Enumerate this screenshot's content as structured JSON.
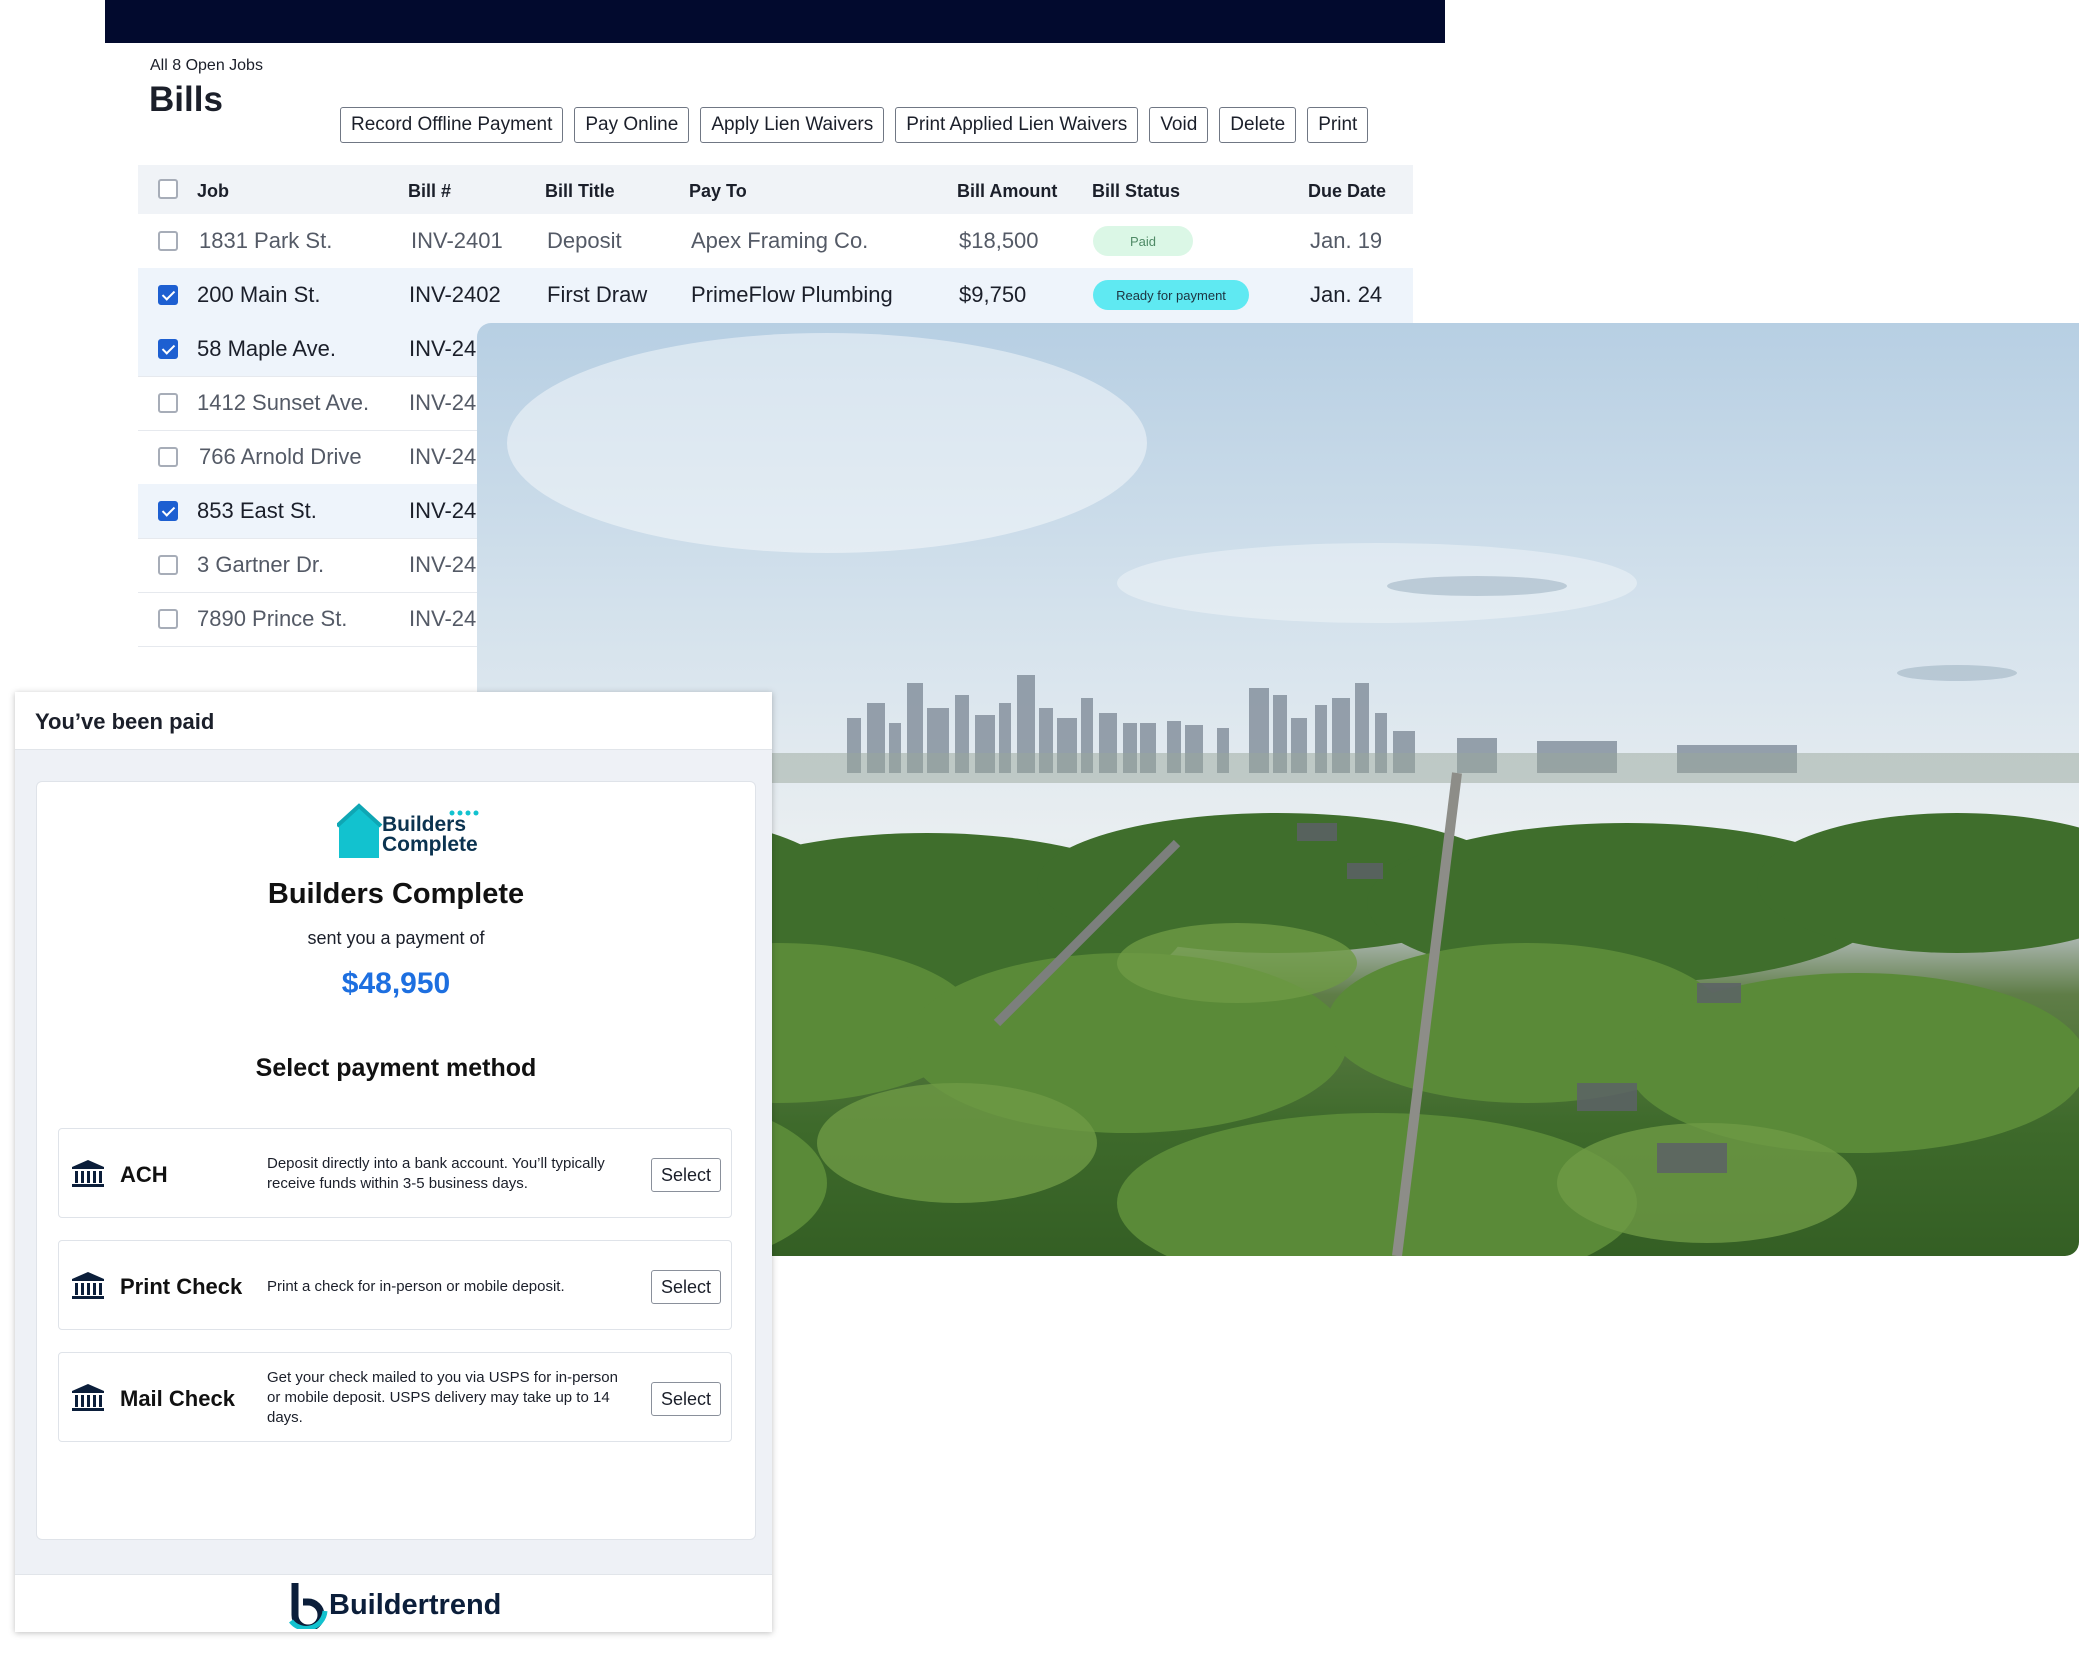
{
  "bills": {
    "breadcrumb": "All 8 Open Jobs",
    "title": "Bills",
    "toolbar": [
      "Record Offline Payment",
      "Pay Online",
      "Apply Lien Waivers",
      "Print Applied Lien Waivers",
      "Void",
      "Delete",
      "Print"
    ],
    "columns": {
      "job": "Job",
      "bill_no": "Bill #",
      "bill_title": "Bill Title",
      "pay_to": "Pay To",
      "bill_amount": "Bill Amount",
      "bill_status": "Bill Status",
      "due_date": "Due Date"
    },
    "rows": [
      {
        "job": "1831 Park St.",
        "bill_no": "INV-2401",
        "bill_title": "Deposit",
        "pay_to": "Apex Framing Co.",
        "amount": "$18,500",
        "status": "Paid",
        "due": "Jan. 19",
        "checked": false
      },
      {
        "job": "200 Main St.",
        "bill_no": "INV-2402",
        "bill_title": "First Draw",
        "pay_to": "PrimeFlow Plumbing",
        "amount": "$9,750",
        "status": "Ready for payment",
        "due": "Jan. 24",
        "checked": true
      },
      {
        "job": "58 Maple Ave.",
        "bill_no": "INV-24",
        "checked": true
      },
      {
        "job": "1412 Sunset Ave.",
        "bill_no": "INV-24",
        "checked": false
      },
      {
        "job": "766 Arnold Drive",
        "bill_no": "INV-24",
        "checked": false
      },
      {
        "job": "853 East St.",
        "bill_no": "INV-24",
        "checked": true
      },
      {
        "job": "3 Gartner Dr.",
        "bill_no": "INV-24",
        "checked": false
      },
      {
        "job": "7890 Prince St.",
        "bill_no": "INV-24",
        "checked": false
      }
    ]
  },
  "payment": {
    "header": "You’ve been paid",
    "logo_line1": "Builders",
    "logo_line2": "Complete",
    "company": "Builders Complete",
    "sent_text": "sent you a payment of",
    "amount": "$48,950",
    "select_heading": "Select payment method",
    "methods": [
      {
        "name": "ACH",
        "desc": "Deposit directly into a bank account. You’ll typically receive funds within 3-5 business days.",
        "button": "Select",
        "icon": "bank-icon"
      },
      {
        "name": "Print Check",
        "desc": "Print a check for in-person or mobile deposit.",
        "button": "Select",
        "icon": "bank-icon"
      },
      {
        "name": "Mail Check",
        "desc": "Get your check mailed to you via USPS for in-person or mobile deposit. USPS delivery may take up to 14 days.",
        "button": "Select",
        "icon": "bank-icon"
      }
    ],
    "footer_brand": "Buildertrend"
  },
  "colors": {
    "topbar": "#020a2e",
    "checkbox_checked": "#1d5fd1",
    "amount_blue": "#1d6fe0",
    "paid_badge": "#dbf7e6",
    "ready_badge": "#5fe9f2",
    "logo_teal": "#12c2cf"
  }
}
